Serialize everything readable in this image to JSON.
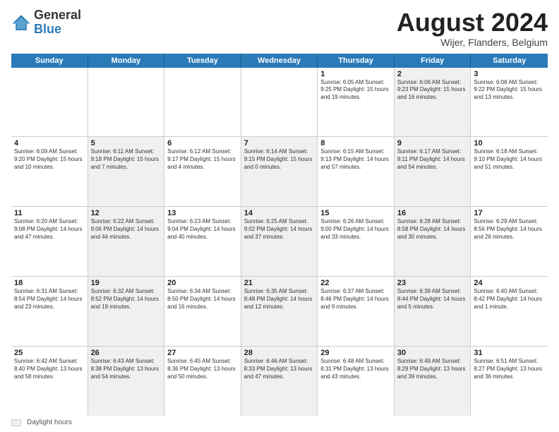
{
  "logo": {
    "general": "General",
    "blue": "Blue"
  },
  "title": {
    "month_year": "August 2024",
    "location": "Wijer, Flanders, Belgium"
  },
  "days_of_week": [
    "Sunday",
    "Monday",
    "Tuesday",
    "Wednesday",
    "Thursday",
    "Friday",
    "Saturday"
  ],
  "weeks": [
    [
      {
        "day": "",
        "detail": "",
        "shaded": false,
        "empty": true
      },
      {
        "day": "",
        "detail": "",
        "shaded": false,
        "empty": true
      },
      {
        "day": "",
        "detail": "",
        "shaded": false,
        "empty": true
      },
      {
        "day": "",
        "detail": "",
        "shaded": false,
        "empty": true
      },
      {
        "day": "1",
        "detail": "Sunrise: 6:05 AM\nSunset: 9:25 PM\nDaylight: 15 hours\nand 19 minutes.",
        "shaded": false,
        "empty": false
      },
      {
        "day": "2",
        "detail": "Sunrise: 6:06 AM\nSunset: 9:23 PM\nDaylight: 15 hours\nand 16 minutes.",
        "shaded": true,
        "empty": false
      },
      {
        "day": "3",
        "detail": "Sunrise: 6:08 AM\nSunset: 9:22 PM\nDaylight: 15 hours\nand 13 minutes.",
        "shaded": false,
        "empty": false
      }
    ],
    [
      {
        "day": "4",
        "detail": "Sunrise: 6:09 AM\nSunset: 9:20 PM\nDaylight: 15 hours\nand 10 minutes.",
        "shaded": false,
        "empty": false
      },
      {
        "day": "5",
        "detail": "Sunrise: 6:11 AM\nSunset: 9:18 PM\nDaylight: 15 hours\nand 7 minutes.",
        "shaded": true,
        "empty": false
      },
      {
        "day": "6",
        "detail": "Sunrise: 6:12 AM\nSunset: 9:17 PM\nDaylight: 15 hours\nand 4 minutes.",
        "shaded": false,
        "empty": false
      },
      {
        "day": "7",
        "detail": "Sunrise: 6:14 AM\nSunset: 9:15 PM\nDaylight: 15 hours\nand 0 minutes.",
        "shaded": true,
        "empty": false
      },
      {
        "day": "8",
        "detail": "Sunrise: 6:15 AM\nSunset: 9:13 PM\nDaylight: 14 hours\nand 57 minutes.",
        "shaded": false,
        "empty": false
      },
      {
        "day": "9",
        "detail": "Sunrise: 6:17 AM\nSunset: 9:11 PM\nDaylight: 14 hours\nand 54 minutes.",
        "shaded": true,
        "empty": false
      },
      {
        "day": "10",
        "detail": "Sunrise: 6:18 AM\nSunset: 9:10 PM\nDaylight: 14 hours\nand 51 minutes.",
        "shaded": false,
        "empty": false
      }
    ],
    [
      {
        "day": "11",
        "detail": "Sunrise: 6:20 AM\nSunset: 9:08 PM\nDaylight: 14 hours\nand 47 minutes.",
        "shaded": false,
        "empty": false
      },
      {
        "day": "12",
        "detail": "Sunrise: 6:22 AM\nSunset: 9:06 PM\nDaylight: 14 hours\nand 44 minutes.",
        "shaded": true,
        "empty": false
      },
      {
        "day": "13",
        "detail": "Sunrise: 6:23 AM\nSunset: 9:04 PM\nDaylight: 14 hours\nand 40 minutes.",
        "shaded": false,
        "empty": false
      },
      {
        "day": "14",
        "detail": "Sunrise: 6:25 AM\nSunset: 9:02 PM\nDaylight: 14 hours\nand 37 minutes.",
        "shaded": true,
        "empty": false
      },
      {
        "day": "15",
        "detail": "Sunrise: 6:26 AM\nSunset: 9:00 PM\nDaylight: 14 hours\nand 33 minutes.",
        "shaded": false,
        "empty": false
      },
      {
        "day": "16",
        "detail": "Sunrise: 6:28 AM\nSunset: 8:58 PM\nDaylight: 14 hours\nand 30 minutes.",
        "shaded": true,
        "empty": false
      },
      {
        "day": "17",
        "detail": "Sunrise: 6:29 AM\nSunset: 8:56 PM\nDaylight: 14 hours\nand 26 minutes.",
        "shaded": false,
        "empty": false
      }
    ],
    [
      {
        "day": "18",
        "detail": "Sunrise: 6:31 AM\nSunset: 8:54 PM\nDaylight: 14 hours\nand 23 minutes.",
        "shaded": false,
        "empty": false
      },
      {
        "day": "19",
        "detail": "Sunrise: 6:32 AM\nSunset: 8:52 PM\nDaylight: 14 hours\nand 19 minutes.",
        "shaded": true,
        "empty": false
      },
      {
        "day": "20",
        "detail": "Sunrise: 6:34 AM\nSunset: 8:50 PM\nDaylight: 14 hours\nand 16 minutes.",
        "shaded": false,
        "empty": false
      },
      {
        "day": "21",
        "detail": "Sunrise: 6:35 AM\nSunset: 8:48 PM\nDaylight: 14 hours\nand 12 minutes.",
        "shaded": true,
        "empty": false
      },
      {
        "day": "22",
        "detail": "Sunrise: 6:37 AM\nSunset: 8:46 PM\nDaylight: 14 hours\nand 9 minutes.",
        "shaded": false,
        "empty": false
      },
      {
        "day": "23",
        "detail": "Sunrise: 6:39 AM\nSunset: 8:44 PM\nDaylight: 14 hours\nand 5 minutes.",
        "shaded": true,
        "empty": false
      },
      {
        "day": "24",
        "detail": "Sunrise: 6:40 AM\nSunset: 8:42 PM\nDaylight: 14 hours\nand 1 minute.",
        "shaded": false,
        "empty": false
      }
    ],
    [
      {
        "day": "25",
        "detail": "Sunrise: 6:42 AM\nSunset: 8:40 PM\nDaylight: 13 hours\nand 58 minutes.",
        "shaded": false,
        "empty": false
      },
      {
        "day": "26",
        "detail": "Sunrise: 6:43 AM\nSunset: 8:38 PM\nDaylight: 13 hours\nand 54 minutes.",
        "shaded": true,
        "empty": false
      },
      {
        "day": "27",
        "detail": "Sunrise: 6:45 AM\nSunset: 8:36 PM\nDaylight: 13 hours\nand 50 minutes.",
        "shaded": false,
        "empty": false
      },
      {
        "day": "28",
        "detail": "Sunrise: 6:46 AM\nSunset: 8:33 PM\nDaylight: 13 hours\nand 47 minutes.",
        "shaded": true,
        "empty": false
      },
      {
        "day": "29",
        "detail": "Sunrise: 6:48 AM\nSunset: 8:31 PM\nDaylight: 13 hours\nand 43 minutes.",
        "shaded": false,
        "empty": false
      },
      {
        "day": "30",
        "detail": "Sunrise: 6:49 AM\nSunset: 8:29 PM\nDaylight: 13 hours\nand 39 minutes.",
        "shaded": true,
        "empty": false
      },
      {
        "day": "31",
        "detail": "Sunrise: 6:51 AM\nSunset: 8:27 PM\nDaylight: 13 hours\nand 36 minutes.",
        "shaded": false,
        "empty": false
      }
    ]
  ],
  "footer": {
    "legend_label": "Daylight hours"
  }
}
